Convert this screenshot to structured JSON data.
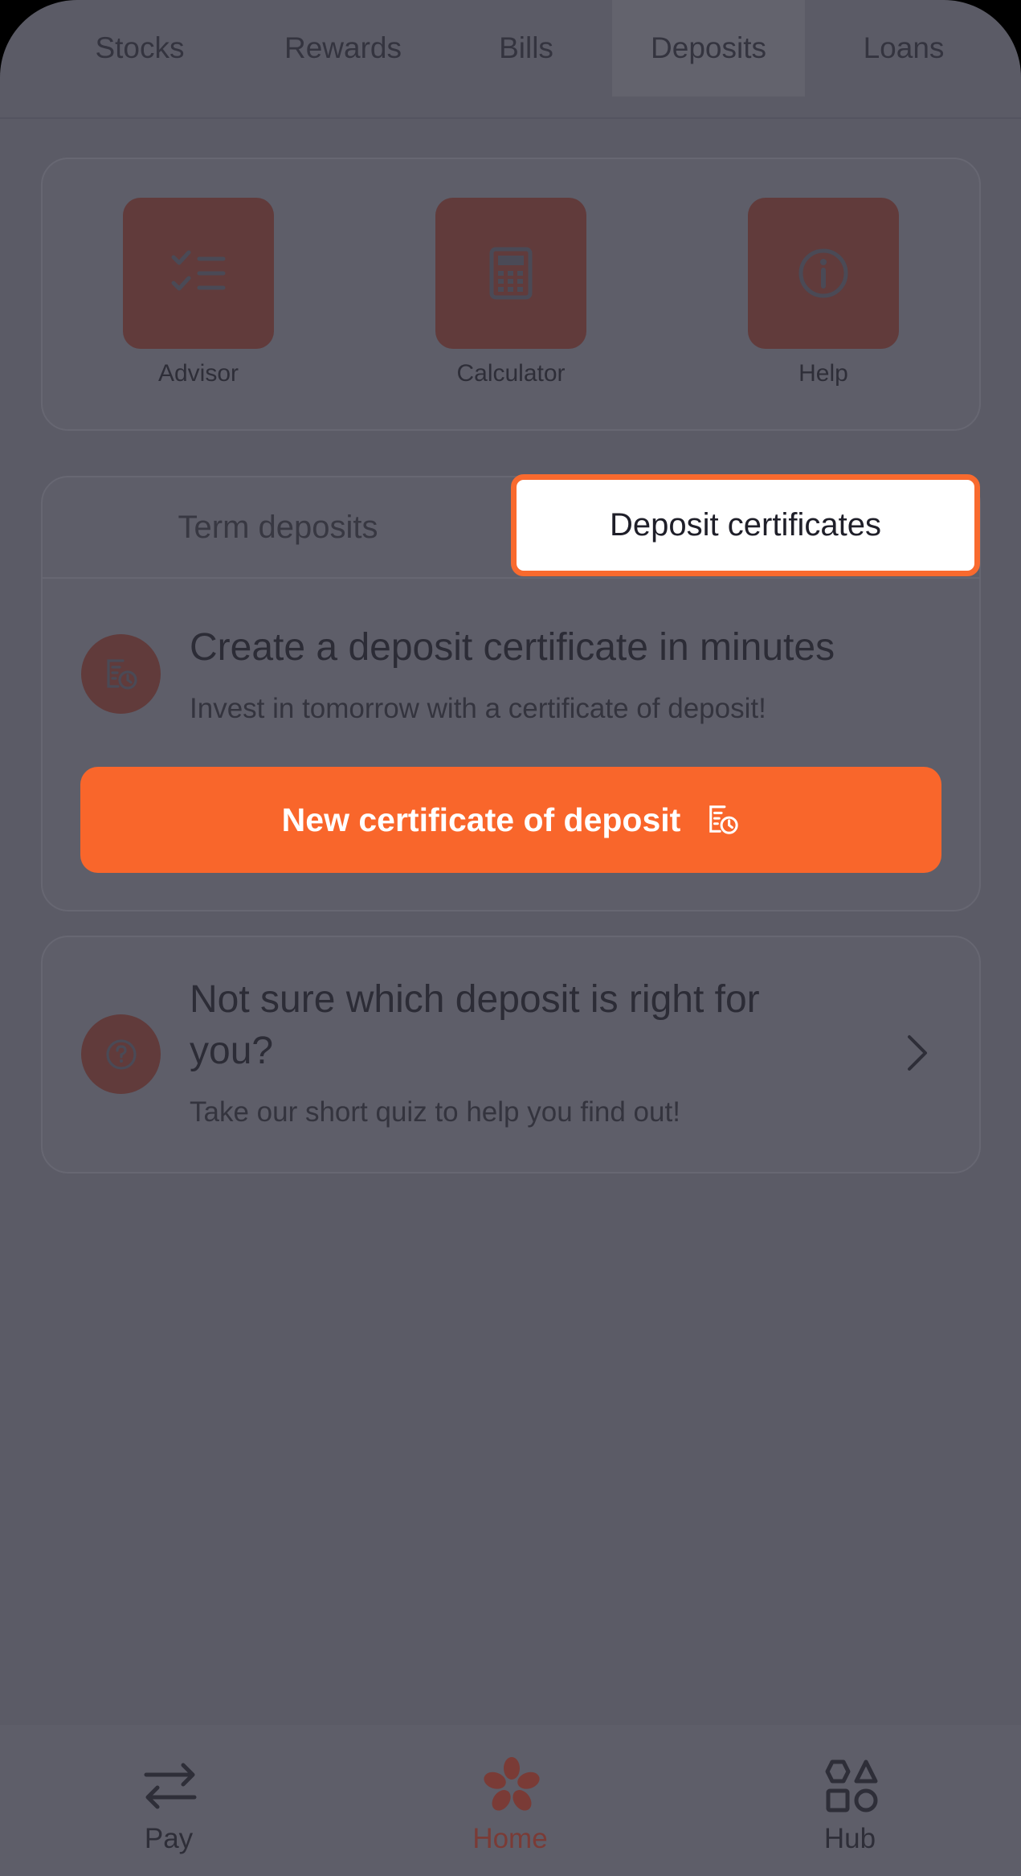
{
  "top_tabs": [
    "Stocks",
    "Rewards",
    "Bills",
    "Deposits",
    "Loans"
  ],
  "active_top_tab": "Deposits",
  "tools": [
    {
      "label": "Advisor",
      "icon": "checklist-icon"
    },
    {
      "label": "Calculator",
      "icon": "calculator-icon"
    },
    {
      "label": "Help",
      "icon": "info-icon"
    }
  ],
  "segments": {
    "left": "Term deposits",
    "right": "Deposit certificates",
    "selected": "Deposit certificates"
  },
  "promo": {
    "title": "Create a deposit certificate in minutes",
    "subtitle": "Invest in tomorrow with a certificate of deposit!",
    "icon": "certificate-clock-icon"
  },
  "cta": {
    "label": "New certificate of deposit",
    "icon": "certificate-clock-icon"
  },
  "quiz": {
    "title": "Not sure which deposit is right for you?",
    "subtitle": "Take our short quiz to help you find out!",
    "icon": "question-icon"
  },
  "bottom_nav": [
    {
      "label": "Pay",
      "icon": "transfer-arrows-icon"
    },
    {
      "label": "Home",
      "icon": "flower-logo-icon"
    },
    {
      "label": "Hub",
      "icon": "shapes-icon"
    }
  ],
  "active_bottom_nav": "Home",
  "colors": {
    "accent": "#f9662b",
    "overlay_background": "#5b5b66",
    "icon_tile": "#613b3b",
    "highlight_border": "#f96a2e"
  }
}
